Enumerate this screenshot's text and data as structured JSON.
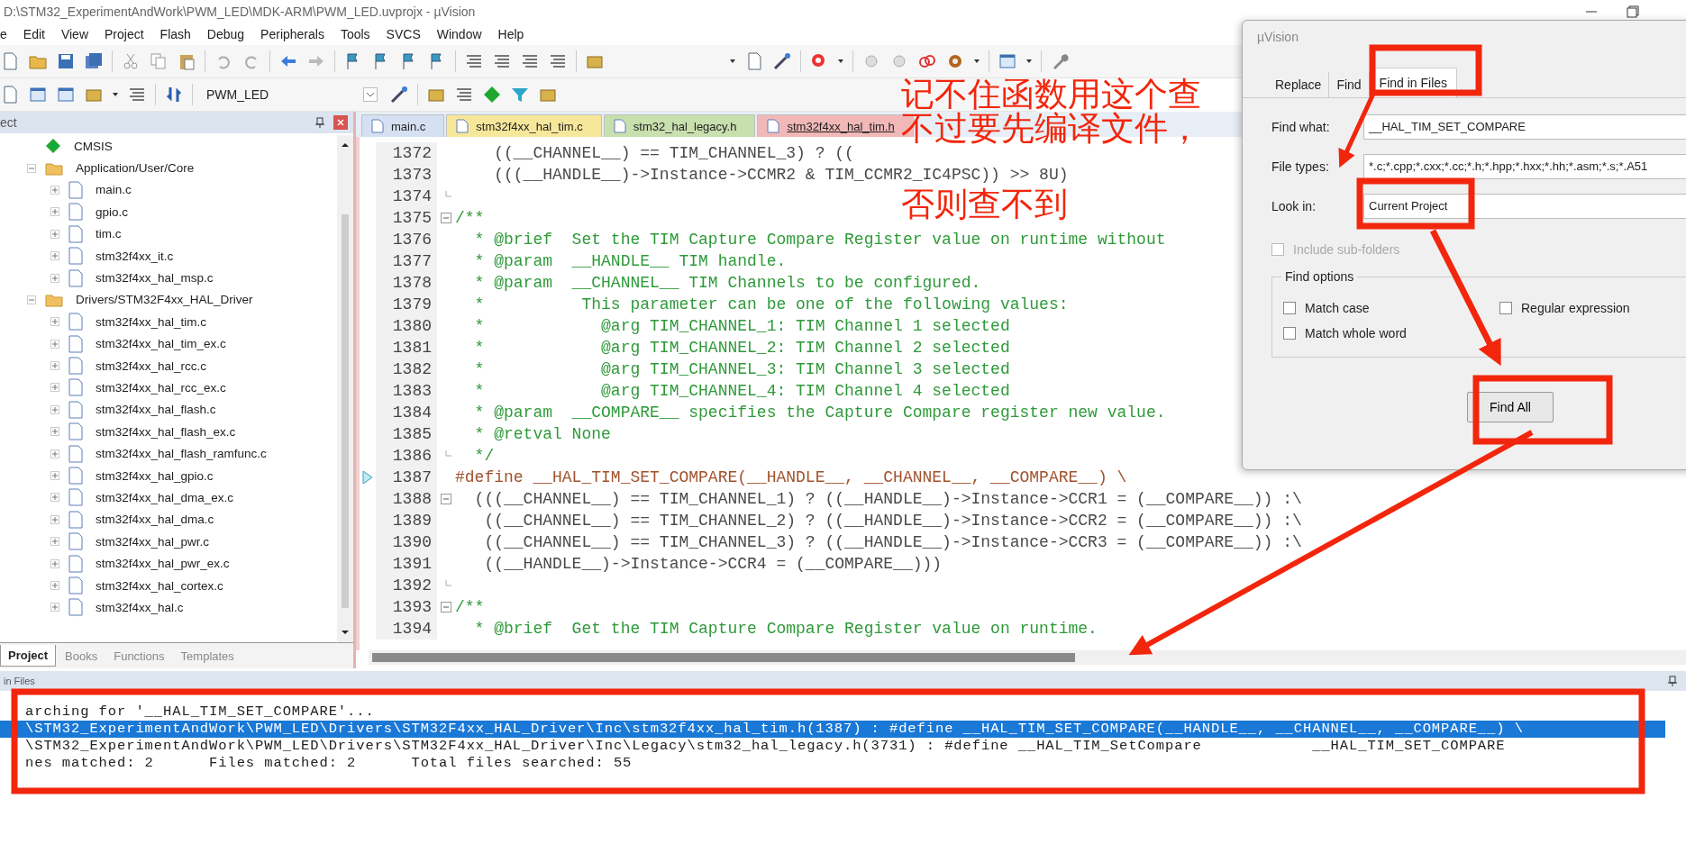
{
  "window": {
    "title": "D:\\STM32_ExperimentAndWork\\PWM_LED\\MDK-ARM\\PWM_LED.uvprojx - µVision"
  },
  "menu": [
    "e",
    "Edit",
    "View",
    "Project",
    "Flash",
    "Debug",
    "Peripherals",
    "Tools",
    "SVCS",
    "Window",
    "Help"
  ],
  "target_select": {
    "value": "PWM_LED"
  },
  "project_panel": {
    "title": "ect",
    "tree": [
      {
        "label": "CMSIS",
        "kind": "component"
      },
      {
        "label": "Application/User/Core",
        "kind": "folder",
        "expanded": true,
        "children": [
          {
            "label": "main.c",
            "kind": "file",
            "expanded": false
          },
          {
            "label": "gpio.c",
            "kind": "file",
            "expanded": false
          },
          {
            "label": "tim.c",
            "kind": "file",
            "expanded": false
          },
          {
            "label": "stm32f4xx_it.c",
            "kind": "file",
            "expanded": false
          },
          {
            "label": "stm32f4xx_hal_msp.c",
            "kind": "file",
            "expanded": false
          }
        ]
      },
      {
        "label": "Drivers/STM32F4xx_HAL_Driver",
        "kind": "folder",
        "expanded": true,
        "children": [
          {
            "label": "stm32f4xx_hal_tim.c",
            "kind": "file",
            "expanded": false
          },
          {
            "label": "stm32f4xx_hal_tim_ex.c",
            "kind": "file",
            "expanded": false
          },
          {
            "label": "stm32f4xx_hal_rcc.c",
            "kind": "file",
            "expanded": false
          },
          {
            "label": "stm32f4xx_hal_rcc_ex.c",
            "kind": "file",
            "expanded": false
          },
          {
            "label": "stm32f4xx_hal_flash.c",
            "kind": "file",
            "expanded": false
          },
          {
            "label": "stm32f4xx_hal_flash_ex.c",
            "kind": "file",
            "expanded": false
          },
          {
            "label": "stm32f4xx_hal_flash_ramfunc.c",
            "kind": "file",
            "expanded": false
          },
          {
            "label": "stm32f4xx_hal_gpio.c",
            "kind": "file",
            "expanded": false
          },
          {
            "label": "stm32f4xx_hal_dma_ex.c",
            "kind": "file",
            "expanded": false
          },
          {
            "label": "stm32f4xx_hal_dma.c",
            "kind": "file",
            "expanded": false
          },
          {
            "label": "stm32f4xx_hal_pwr.c",
            "kind": "file",
            "expanded": false
          },
          {
            "label": "stm32f4xx_hal_pwr_ex.c",
            "kind": "file",
            "expanded": false
          },
          {
            "label": "stm32f4xx_hal_cortex.c",
            "kind": "file",
            "expanded": false
          },
          {
            "label": "stm32f4xx_hal.c",
            "kind": "file",
            "expanded": false
          }
        ]
      }
    ],
    "tabs": [
      {
        "label": "Project",
        "selected": true
      },
      {
        "label": "Books",
        "selected": false
      },
      {
        "label": "Functions",
        "selected": false
      },
      {
        "label": "Templates",
        "selected": false
      }
    ]
  },
  "editor": {
    "tabs": [
      {
        "label": "main.c",
        "color": "#d5e0f2",
        "selected": false
      },
      {
        "label": "stm32f4xx_hal_tim.c",
        "color": "#f6e79a",
        "selected": false
      },
      {
        "label": "stm32_hal_legacy.h",
        "color": "#c8dfae",
        "selected": false
      },
      {
        "label": "stm32f4xx_hal_tim.h",
        "color": "#f2b8b8",
        "selected": true
      }
    ],
    "lines": [
      {
        "number": "1372",
        "kind": "code",
        "text": "    ((__CHANNEL__) == TIM_CHANNEL_3) ? (("
      },
      {
        "number": "1373",
        "kind": "code",
        "text": "    (((__HANDLE__)->Instance->CCMR2 & TIM_CCMR2_IC4PSC)) >> 8U)"
      },
      {
        "number": "1374",
        "fold_end": true
      },
      {
        "number": "1375",
        "kind": "comment",
        "text": "/**",
        "fold_start": true
      },
      {
        "number": "1376",
        "kind": "comment",
        "text": "  * @brief  Set the TIM Capture Compare Register value on runtime without"
      },
      {
        "number": "1377",
        "kind": "comment",
        "text": "  * @param  __HANDLE__ TIM handle."
      },
      {
        "number": "1378",
        "kind": "comment",
        "text": "  * @param  __CHANNEL__ TIM Channels to be configured."
      },
      {
        "number": "1379",
        "kind": "comment",
        "text": "  *          This parameter can be one of the following values:"
      },
      {
        "number": "1380",
        "kind": "comment",
        "text": "  *            @arg TIM_CHANNEL_1: TIM Channel 1 selected"
      },
      {
        "number": "1381",
        "kind": "comment",
        "text": "  *            @arg TIM_CHANNEL_2: TIM Channel 2 selected"
      },
      {
        "number": "1382",
        "kind": "comment",
        "text": "  *            @arg TIM_CHANNEL_3: TIM Channel 3 selected"
      },
      {
        "number": "1383",
        "kind": "comment",
        "text": "  *            @arg TIM_CHANNEL_4: TIM Channel 4 selected"
      },
      {
        "number": "1384",
        "kind": "comment",
        "text": "  * @param  __COMPARE__ specifies the Capture Compare register new value."
      },
      {
        "number": "1385",
        "kind": "comment",
        "text": "  * @retval None"
      },
      {
        "number": "1386",
        "kind": "comment",
        "text": "  */",
        "fold_end": true
      },
      {
        "number": "1387",
        "kind": "define",
        "text": "#define __HAL_TIM_SET_COMPARE(__HANDLE__, __CHANNEL__, __COMPARE__) \\",
        "marker": true
      },
      {
        "number": "1388",
        "kind": "code",
        "text": "  (((__CHANNEL__) == TIM_CHANNEL_1) ? ((__HANDLE__)->Instance->CCR1 = (__COMPARE__)) :\\",
        "fold_start": true
      },
      {
        "number": "1389",
        "kind": "code",
        "text": "   ((__CHANNEL__) == TIM_CHANNEL_2) ? ((__HANDLE__)->Instance->CCR2 = (__COMPARE__)) :\\"
      },
      {
        "number": "1390",
        "kind": "code",
        "text": "   ((__CHANNEL__) == TIM_CHANNEL_3) ? ((__HANDLE__)->Instance->CCR3 = (__COMPARE__)) :\\"
      },
      {
        "number": "1391",
        "kind": "code",
        "text": "   ((__HANDLE__)->Instance->CCR4 = (__COMPARE__)))"
      },
      {
        "number": "1392",
        "fold_end": true
      },
      {
        "number": "1393",
        "kind": "comment",
        "text": "/**",
        "fold_start": true
      },
      {
        "number": "1394",
        "kind": "comment",
        "text": "  * @brief  Get the TIM Capture Compare Register value on runtime."
      }
    ]
  },
  "find_dialog": {
    "title": "µVision",
    "tabs": [
      {
        "label": "Replace",
        "selected": false
      },
      {
        "label": "Find",
        "selected": false
      },
      {
        "label": "Find in Files",
        "selected": true
      }
    ],
    "fields": [
      {
        "label": "Find what:",
        "value": "__HAL_TIM_SET_COMPARE"
      },
      {
        "label": "File types:",
        "value": "*.c;*.cpp;*.cxx;*.cc;*.h;*.hpp;*.hxx;*.hh;*.asm;*.s;*.A51"
      },
      {
        "label": "Look in:",
        "value": "Current Project"
      }
    ],
    "include_subfolders": {
      "label": "Include sub-folders",
      "checked": false,
      "disabled": true
    },
    "options_title": "Find options",
    "options": [
      {
        "label": "Match case",
        "checked": false
      },
      {
        "label": "Regular expression",
        "checked": false
      },
      {
        "label": "Match whole word",
        "checked": false
      }
    ],
    "button": "Find All"
  },
  "output": {
    "title": "in Files",
    "lines": [
      {
        "text": "arching for '__HAL_TIM_SET_COMPARE'...",
        "selected": false
      },
      {
        "text": "\\STM32_ExperimentAndWork\\PWM_LED\\Drivers\\STM32F4xx_HAL_Driver\\Inc\\stm32f4xx_hal_tim.h(1387) : #define __HAL_TIM_SET_COMPARE(__HANDLE__, __CHANNEL__, __COMPARE__) \\",
        "selected": true
      },
      {
        "text": "\\STM32_ExperimentAndWork\\PWM_LED\\Drivers\\STM32F4xx_HAL_Driver\\Inc\\Legacy\\stm32_hal_legacy.h(3731) : #define __HAL_TIM_SetCompare            __HAL_TIM_SET_COMPARE",
        "selected": false
      },
      {
        "text": "nes matched: 2      Files matched: 2      Total files searched: 55",
        "selected": false
      }
    ]
  },
  "annotation": {
    "lines": [
      "记不住函数用这个查",
      "不过要先编译文件，",
      "否则查不到"
    ]
  }
}
